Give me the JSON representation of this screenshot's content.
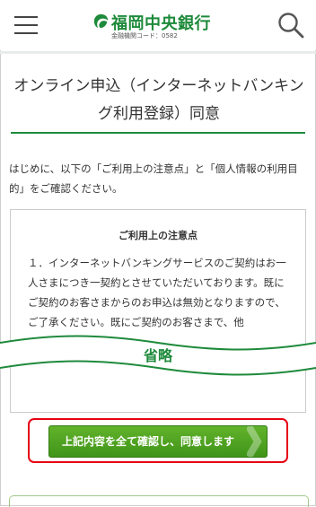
{
  "header": {
    "bank_name": "福岡中央銀行",
    "bank_code": "金融機関コード：0582",
    "brand_color": "#1e8a3b"
  },
  "page": {
    "title": "オンライン申込（インターネットバンキング利用登録）同意",
    "intro": "はじめに、以下の「ご利用上の注意点」と「個人情報の利用目的」をご確認ください。"
  },
  "terms": {
    "heading": "ご利用上の注意点",
    "body": "１．インターネットバンキングサービスのご契約はお一人さまにつき一契約とさせていただいております。既にご契約のお客さまからのお申込は無効となりますので、ご了承ください。既にご契約のお客さまで、他"
  },
  "omitted_label": "省略",
  "agree_button_label": "上記内容を全て確認し、同意します",
  "colors": {
    "accent": "#1e8a3b",
    "button": "#4ca321",
    "highlight": "#e60012"
  },
  "icons": {
    "menu": "hamburger-icon",
    "search": "search-icon",
    "logo": "bank-logo-mark"
  }
}
